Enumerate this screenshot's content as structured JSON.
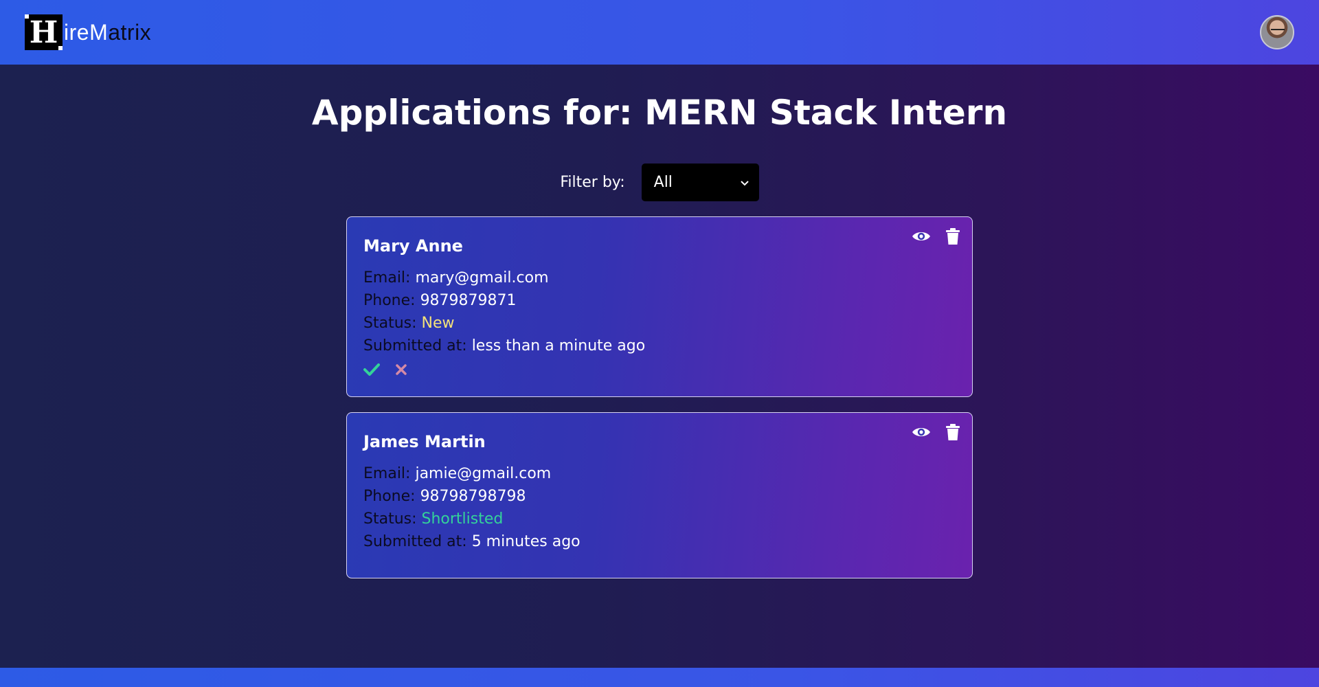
{
  "header": {
    "logo_letter": "H",
    "logo_text_1": "ire",
    "logo_text_2": "M",
    "logo_text_3": "atrix"
  },
  "page": {
    "title": "Applications for: MERN Stack Intern"
  },
  "filter": {
    "label": "Filter by:",
    "selected": "All"
  },
  "applications": [
    {
      "name": "Mary Anne",
      "email_label": "Email:",
      "email": "mary@gmail.com",
      "phone_label": "Phone:",
      "phone": "9879879871",
      "status_label": "Status:",
      "status": "New",
      "submitted_label": "Submitted at:",
      "submitted": "less than a minute ago"
    },
    {
      "name": "James Martin",
      "email_label": "Email:",
      "email": "jamie@gmail.com",
      "phone_label": "Phone:",
      "phone": "98798798798",
      "status_label": "Status:",
      "status": "Shortlisted",
      "submitted_label": "Submitted at:",
      "submitted": "5 minutes ago"
    }
  ],
  "colors": {
    "status_new": "#f4e27a",
    "status_shortlisted": "#34d399",
    "accept": "#34d399",
    "reject": "#d48aa6"
  },
  "icons": [
    "eye-icon",
    "trash-icon",
    "check-icon",
    "close-icon",
    "chevron-down-icon"
  ]
}
